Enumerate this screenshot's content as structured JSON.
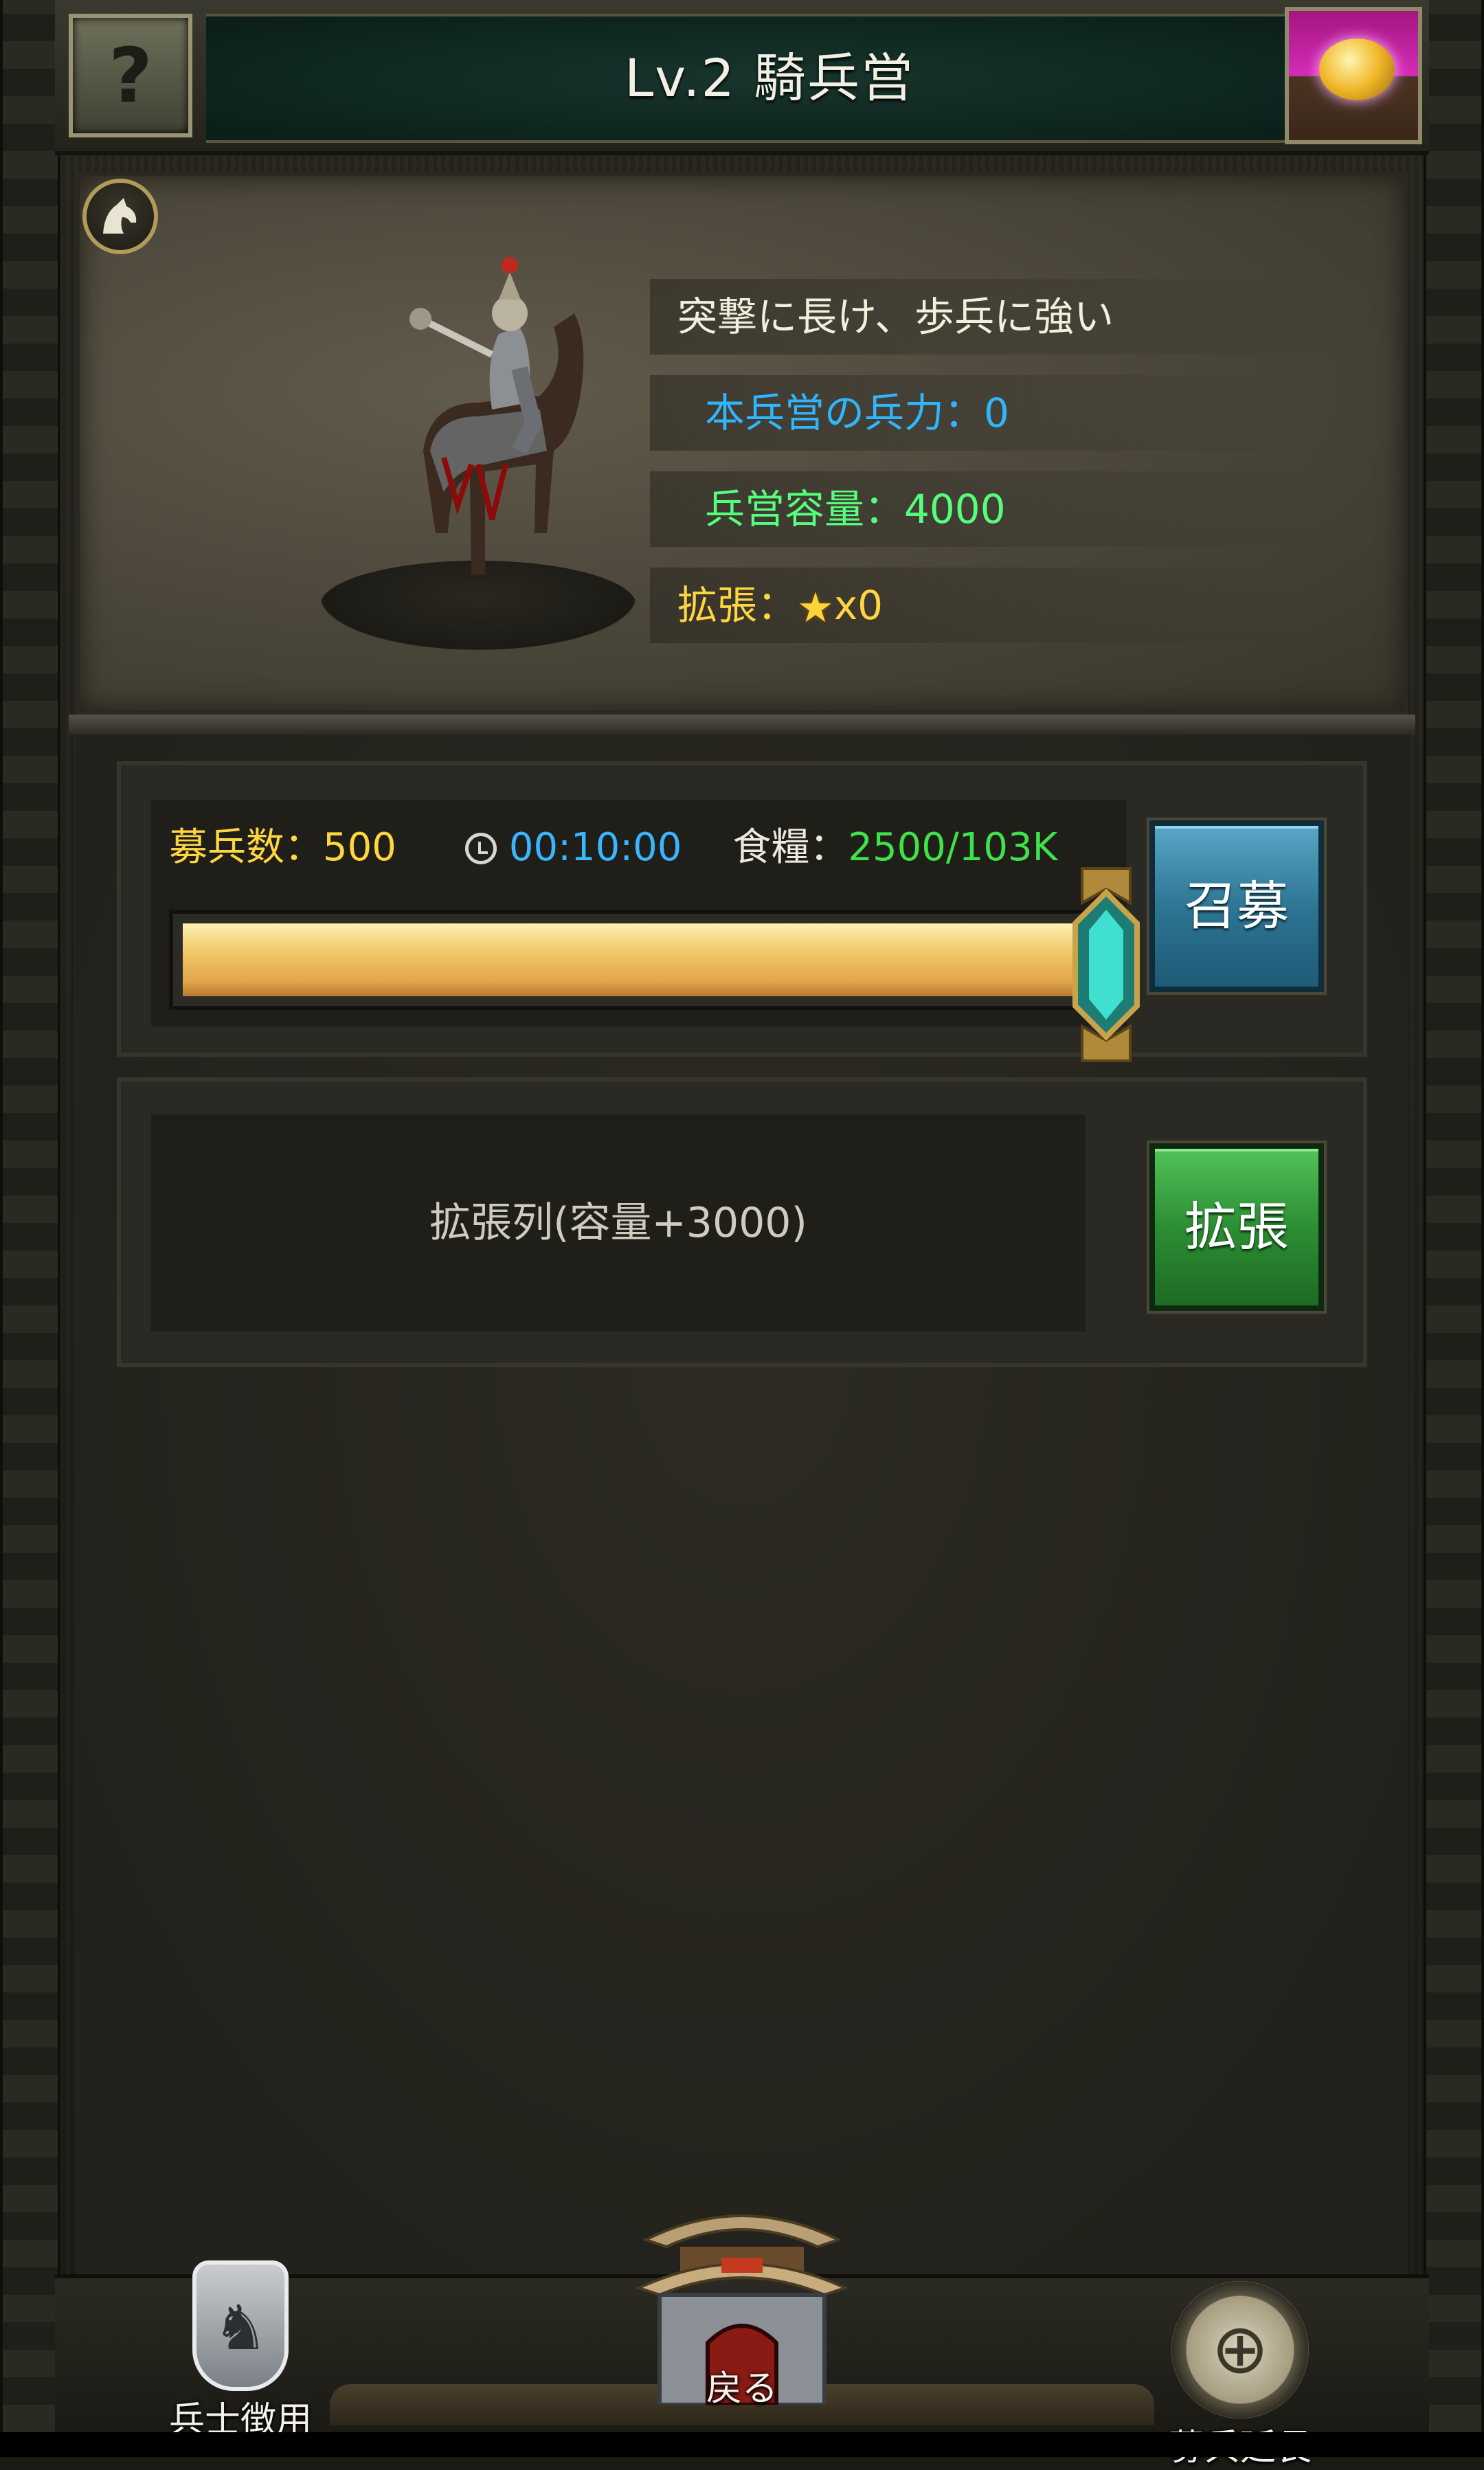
{
  "header": {
    "title": "Lv.2 騎兵営",
    "help_label": "?"
  },
  "info": {
    "description": "突撃に長け、歩兵に強い",
    "troops_label": "本兵営の兵力：0",
    "capacity_label": "兵営容量：4000",
    "expand_label": "拡張：",
    "expand_count": "x0"
  },
  "recruit": {
    "count_label": "募兵数：500",
    "time": "00:10:00",
    "food_label": "食糧：",
    "food_value": "2500/103K",
    "slider_fraction": 0.97,
    "button_label": "召募"
  },
  "expand": {
    "queue_label": "拡張列(容量+3000)",
    "button_label": "拡張"
  },
  "bottom_nav": {
    "soldier_label": "兵士徴用",
    "back_label": "戻る",
    "extend_label": "募兵延長"
  },
  "colors": {
    "troops": "#2fb6ff",
    "capacity": "#54ff7c",
    "expand": "#ffd540",
    "recruit_button": "#2d7694",
    "expand_button": "#2c8e34"
  }
}
